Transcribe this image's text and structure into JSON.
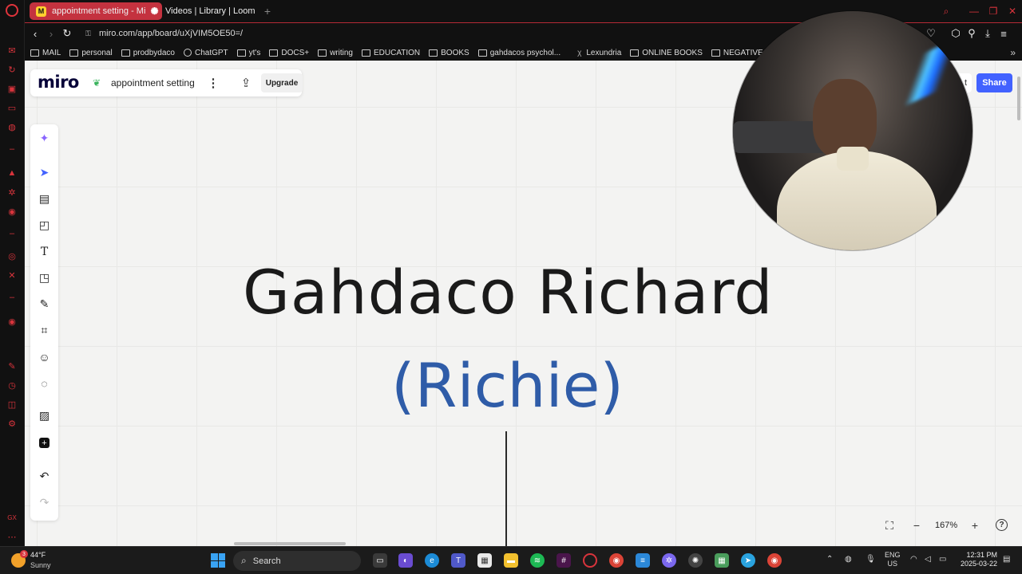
{
  "browser": {
    "tabs": [
      {
        "label": "appointment setting - Mi",
        "favicon": "M",
        "active": true
      },
      {
        "label": "Videos | Library | Loom",
        "favicon": "✺",
        "active": false
      }
    ],
    "url": "miro.com/app/board/uXjVIM5OE50=/",
    "bookmarks": [
      "MAIL",
      "personal",
      "prodbydaco",
      "ChatGPT",
      "yt's",
      "DOCS+",
      "writing",
      "EDUCATION",
      "BOOKS",
      "gahdacos psychol...",
      "Lexundria",
      "ONLINE BOOKS",
      "NEGATIVE DESIRE"
    ]
  },
  "miro": {
    "logo": "miro",
    "board_name": "appointment setting",
    "upgrade_label": "Upgrade",
    "share_label": "Share",
    "presence_label": "t",
    "zoom": "167%",
    "help": "?"
  },
  "canvas": {
    "title": "Gahdaco Richard",
    "subtitle": "(Richie)"
  },
  "taskbar": {
    "temperature": "44°F",
    "condition": "Sunny",
    "weather_badge": "3",
    "search_label": "Search",
    "language": "ENG",
    "region": "US",
    "time": "12:31 PM",
    "date": "2025-03-22"
  },
  "colors": {
    "accent": "#c4323f",
    "miro_blue": "#4262ff",
    "subtitle_blue": "#2f5ca8"
  }
}
